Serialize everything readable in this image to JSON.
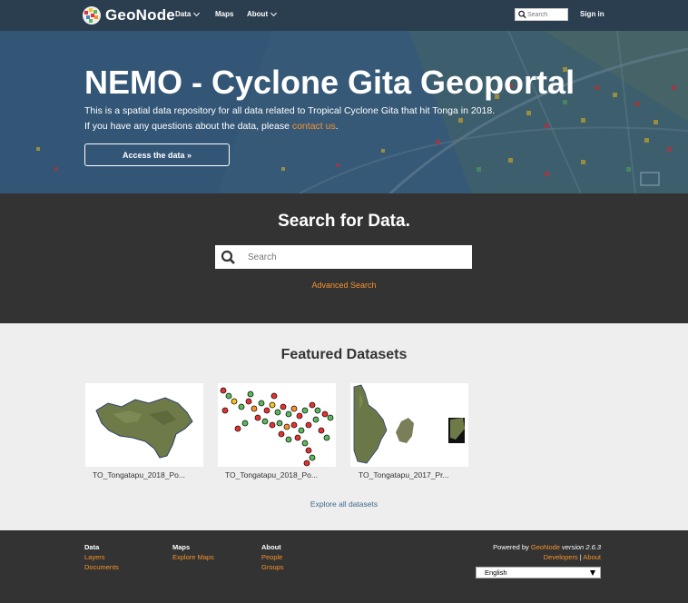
{
  "navbar": {
    "brand": "GeoNode",
    "items": [
      {
        "label": "Data",
        "dropdown": true
      },
      {
        "label": "Maps",
        "dropdown": false
      },
      {
        "label": "About",
        "dropdown": true
      }
    ],
    "search_placeholder": "Search",
    "signin": "Sign in"
  },
  "hero": {
    "title": "NEMO - Cyclone Gita Geoportal",
    "line1": "This is a spatial data repository for all data related to Tropical Cyclone Gita that hit Tonga in 2018.",
    "line2_prefix": "If you have any questions about the data, please ",
    "contact_link": "contact us",
    "line2_suffix": ".",
    "button": "Access the data »"
  },
  "search": {
    "title": "Search for Data.",
    "placeholder": "Search",
    "advanced": "Advanced Search"
  },
  "featured": {
    "title": "Featured Datasets",
    "datasets": [
      {
        "label": "TO_Tongatapu_2018_Po..."
      },
      {
        "label": "TO_Tongatapu_2018_Po..."
      },
      {
        "label": "TO_Tongatapu_2017_Pr..."
      }
    ],
    "explore": "Explore all datasets"
  },
  "footer": {
    "columns": [
      {
        "head": "Data",
        "links": [
          "Layers",
          "Documents"
        ]
      },
      {
        "head": "Maps",
        "links": [
          "Explore Maps"
        ]
      },
      {
        "head": "About",
        "links": [
          "People",
          "Groups"
        ]
      }
    ],
    "powered_prefix": "Powered by ",
    "powered_link": "GeoNode",
    "version": " version 2.6.3",
    "developers": "Developers",
    "sep": " | ",
    "about": "About",
    "language": "English"
  },
  "colors": {
    "navbar": "#2b3e4f",
    "accent": "#f7922a",
    "dark_section": "#333333",
    "light_section": "#eeeeee"
  }
}
